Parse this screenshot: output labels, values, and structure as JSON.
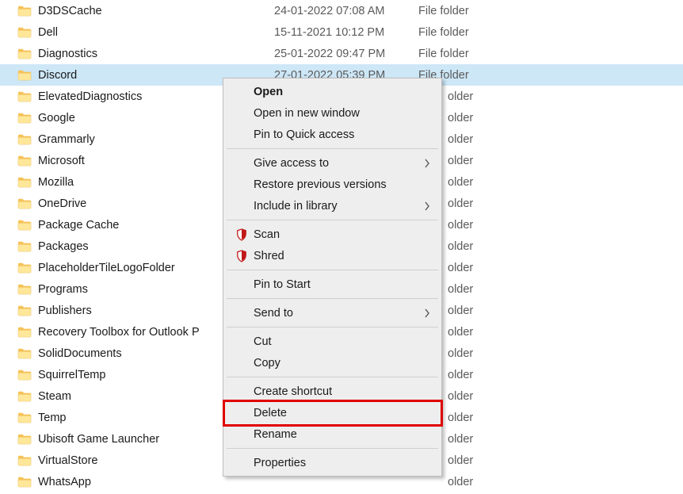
{
  "rows": [
    {
      "name": "D3DSCache",
      "date": "24-01-2022 07:08 AM",
      "type": "File folder",
      "selected": false
    },
    {
      "name": "Dell",
      "date": "15-11-2021 10:12 PM",
      "type": "File folder",
      "selected": false
    },
    {
      "name": "Diagnostics",
      "date": "25-01-2022 09:47 PM",
      "type": "File folder",
      "selected": false
    },
    {
      "name": "Discord",
      "date": "27-01-2022 05:39 PM",
      "type": "File folder",
      "selected": true
    },
    {
      "name": "ElevatedDiagnostics",
      "date": "",
      "type": "",
      "selected": false
    },
    {
      "name": "Google",
      "date": "",
      "type": "",
      "selected": false
    },
    {
      "name": "Grammarly",
      "date": "",
      "type": "",
      "selected": false
    },
    {
      "name": "Microsoft",
      "date": "",
      "type": "",
      "selected": false
    },
    {
      "name": "Mozilla",
      "date": "",
      "type": "",
      "selected": false
    },
    {
      "name": "OneDrive",
      "date": "",
      "type": "",
      "selected": false
    },
    {
      "name": "Package Cache",
      "date": "",
      "type": "",
      "selected": false
    },
    {
      "name": "Packages",
      "date": "",
      "type": "",
      "selected": false
    },
    {
      "name": "PlaceholderTileLogoFolder",
      "date": "",
      "type": "",
      "selected": false
    },
    {
      "name": "Programs",
      "date": "",
      "type": "",
      "selected": false
    },
    {
      "name": "Publishers",
      "date": "",
      "type": "",
      "selected": false
    },
    {
      "name": "Recovery Toolbox for Outlook P",
      "date": "",
      "type": "",
      "selected": false
    },
    {
      "name": "SolidDocuments",
      "date": "",
      "type": "",
      "selected": false
    },
    {
      "name": "SquirrelTemp",
      "date": "",
      "type": "",
      "selected": false
    },
    {
      "name": "Steam",
      "date": "",
      "type": "",
      "selected": false
    },
    {
      "name": "Temp",
      "date": "",
      "type": "",
      "selected": false
    },
    {
      "name": "Ubisoft Game Launcher",
      "date": "",
      "type": "",
      "selected": false
    },
    {
      "name": "VirtualStore",
      "date": "",
      "type": "",
      "selected": false
    },
    {
      "name": "WhatsApp",
      "date": "",
      "type": "",
      "selected": false
    }
  ],
  "context_menu": {
    "groups": [
      [
        {
          "label": "Open",
          "bold": true,
          "submenu": false,
          "icon": null
        },
        {
          "label": "Open in new window",
          "bold": false,
          "submenu": false,
          "icon": null
        },
        {
          "label": "Pin to Quick access",
          "bold": false,
          "submenu": false,
          "icon": null
        }
      ],
      [
        {
          "label": "Give access to",
          "bold": false,
          "submenu": true,
          "icon": null
        },
        {
          "label": "Restore previous versions",
          "bold": false,
          "submenu": false,
          "icon": null
        },
        {
          "label": "Include in library",
          "bold": false,
          "submenu": true,
          "icon": null
        }
      ],
      [
        {
          "label": "Scan",
          "bold": false,
          "submenu": false,
          "icon": "shield"
        },
        {
          "label": "Shred",
          "bold": false,
          "submenu": false,
          "icon": "shield"
        }
      ],
      [
        {
          "label": "Pin to Start",
          "bold": false,
          "submenu": false,
          "icon": null
        }
      ],
      [
        {
          "label": "Send to",
          "bold": false,
          "submenu": true,
          "icon": null
        }
      ],
      [
        {
          "label": "Cut",
          "bold": false,
          "submenu": false,
          "icon": null
        },
        {
          "label": "Copy",
          "bold": false,
          "submenu": false,
          "icon": null
        }
      ],
      [
        {
          "label": "Create shortcut",
          "bold": false,
          "submenu": false,
          "icon": null
        },
        {
          "label": "Delete",
          "bold": false,
          "submenu": false,
          "icon": null,
          "highlight": true
        },
        {
          "label": "Rename",
          "bold": false,
          "submenu": false,
          "icon": null
        }
      ],
      [
        {
          "label": "Properties",
          "bold": false,
          "submenu": false,
          "icon": null
        }
      ]
    ]
  },
  "type_suffix": "older",
  "colors": {
    "selection_bg": "#cde7f7",
    "highlight_border": "#e00000"
  }
}
